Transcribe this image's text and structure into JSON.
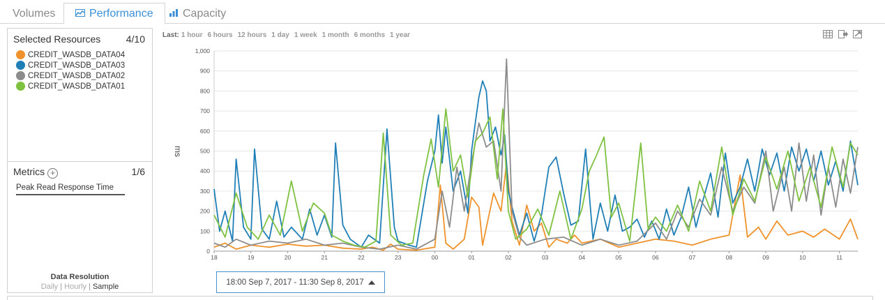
{
  "tabs": [
    {
      "label": "Volumes",
      "icon": "none"
    },
    {
      "label": "Performance",
      "icon": "line-chart-icon"
    },
    {
      "label": "Capacity",
      "icon": "bar-chart-icon"
    }
  ],
  "resources": {
    "title": "Selected Resources",
    "count": "4/10",
    "items": [
      {
        "name": "CREDIT_WASDB_DATA04",
        "color": "#f0922b"
      },
      {
        "name": "CREDIT_WASDB_DATA03",
        "color": "#1f7fb6"
      },
      {
        "name": "CREDIT_WASDB_DATA02",
        "color": "#8c8c8c"
      },
      {
        "name": "CREDIT_WASDB_DATA01",
        "color": "#7fc241"
      }
    ]
  },
  "metrics": {
    "title": "Metrics",
    "count": "1/6",
    "items": [
      "Peak Read Response Time"
    ]
  },
  "resolution": {
    "title": "Data Resolution",
    "options": [
      "Daily",
      "Hourly",
      "Sample"
    ],
    "selected": "Sample"
  },
  "timebar": {
    "label": "Last:",
    "options": [
      "1 hour",
      "6 hours",
      "12 hours",
      "1 day",
      "1 week",
      "1 month",
      "6 months",
      "1 year"
    ]
  },
  "tools": [
    "table-icon",
    "export-icon",
    "expand-icon"
  ],
  "range": {
    "label": "18:00 Sep 7, 2017 - 11:30 Sep 8, 2017"
  },
  "chart_data": {
    "type": "line",
    "ylabel": "ms",
    "xlabel": "",
    "ylim": [
      0,
      1000
    ],
    "yticks": [
      "0",
      "100",
      "200",
      "300",
      "400",
      "500",
      "600",
      "700",
      "800",
      "900",
      "1,000"
    ],
    "xticks": [
      "18",
      "19",
      "20",
      "21",
      "22",
      "23",
      "00",
      "01",
      "02",
      "03",
      "04",
      "05",
      "06",
      "07",
      "08",
      "09",
      "10",
      "11"
    ],
    "xrange": [
      0,
      17.5
    ],
    "grid": true,
    "series": [
      {
        "name": "CREDIT_WASDB_DATA04",
        "color": "#f0922b",
        "points": [
          [
            0,
            20
          ],
          [
            0.3,
            40
          ],
          [
            0.6,
            10
          ],
          [
            1,
            30
          ],
          [
            1.5,
            20
          ],
          [
            2,
            35
          ],
          [
            2.5,
            25
          ],
          [
            3,
            30
          ],
          [
            3.5,
            15
          ],
          [
            4,
            10
          ],
          [
            4.3,
            20
          ],
          [
            4.6,
            5
          ],
          [
            4.8,
            35
          ],
          [
            5,
            10
          ],
          [
            5.5,
            5
          ],
          [
            6,
            20
          ],
          [
            6.15,
            330
          ],
          [
            6.3,
            40
          ],
          [
            6.5,
            10
          ],
          [
            6.8,
            60
          ],
          [
            7,
            270
          ],
          [
            7.2,
            220
          ],
          [
            7.3,
            30
          ],
          [
            7.6,
            290
          ],
          [
            7.8,
            200
          ],
          [
            7.95,
            440
          ],
          [
            8.1,
            150
          ],
          [
            8.3,
            30
          ],
          [
            8.5,
            230
          ],
          [
            8.7,
            100
          ],
          [
            8.9,
            140
          ],
          [
            9.1,
            20
          ],
          [
            9.3,
            60
          ],
          [
            9.6,
            40
          ],
          [
            9.8,
            80
          ],
          [
            10,
            40
          ],
          [
            10.5,
            60
          ],
          [
            11,
            20
          ],
          [
            11.5,
            40
          ],
          [
            12,
            60
          ],
          [
            12.5,
            50
          ],
          [
            13,
            30
          ],
          [
            13.5,
            60
          ],
          [
            14,
            80
          ],
          [
            14.3,
            380
          ],
          [
            14.5,
            70
          ],
          [
            14.8,
            120
          ],
          [
            15,
            60
          ],
          [
            15.3,
            150
          ],
          [
            15.6,
            80
          ],
          [
            16,
            100
          ],
          [
            16.3,
            70
          ],
          [
            16.6,
            110
          ],
          [
            17,
            60
          ],
          [
            17.3,
            160
          ],
          [
            17.5,
            60
          ]
        ]
      },
      {
        "name": "CREDIT_WASDB_DATA03",
        "color": "#1f7fb6",
        "points": [
          [
            0,
            310
          ],
          [
            0.15,
            100
          ],
          [
            0.3,
            200
          ],
          [
            0.5,
            50
          ],
          [
            0.6,
            460
          ],
          [
            0.8,
            120
          ],
          [
            1,
            60
          ],
          [
            1.1,
            510
          ],
          [
            1.3,
            110
          ],
          [
            1.5,
            60
          ],
          [
            1.7,
            250
          ],
          [
            1.9,
            70
          ],
          [
            2.1,
            120
          ],
          [
            2.4,
            60
          ],
          [
            2.6,
            210
          ],
          [
            2.8,
            80
          ],
          [
            3,
            180
          ],
          [
            3.2,
            70
          ],
          [
            3.3,
            540
          ],
          [
            3.5,
            130
          ],
          [
            3.7,
            60
          ],
          [
            4,
            20
          ],
          [
            4.2,
            80
          ],
          [
            4.5,
            40
          ],
          [
            4.7,
            610
          ],
          [
            4.9,
            120
          ],
          [
            5,
            50
          ],
          [
            5.3,
            30
          ],
          [
            5.5,
            20
          ],
          [
            5.8,
            350
          ],
          [
            6,
            500
          ],
          [
            6.1,
            680
          ],
          [
            6.2,
            440
          ],
          [
            6.3,
            620
          ],
          [
            6.5,
            300
          ],
          [
            6.7,
            400
          ],
          [
            6.9,
            190
          ],
          [
            7,
            500
          ],
          [
            7.1,
            640
          ],
          [
            7.2,
            770
          ],
          [
            7.3,
            850
          ],
          [
            7.4,
            800
          ],
          [
            7.5,
            550
          ],
          [
            7.65,
            620
          ],
          [
            7.8,
            480
          ],
          [
            7.9,
            580
          ],
          [
            8,
            300
          ],
          [
            8.1,
            220
          ],
          [
            8.3,
            80
          ],
          [
            8.5,
            190
          ],
          [
            8.7,
            50
          ],
          [
            8.9,
            180
          ],
          [
            9.1,
            420
          ],
          [
            9.3,
            470
          ],
          [
            9.5,
            290
          ],
          [
            9.7,
            130
          ],
          [
            9.9,
            150
          ],
          [
            10.1,
            510
          ],
          [
            10.3,
            60
          ],
          [
            10.5,
            240
          ],
          [
            10.7,
            100
          ],
          [
            10.9,
            280
          ],
          [
            11.1,
            100
          ],
          [
            11.3,
            120
          ],
          [
            11.5,
            160
          ],
          [
            11.7,
            70
          ],
          [
            11.9,
            150
          ],
          [
            12.1,
            60
          ],
          [
            12.3,
            210
          ],
          [
            12.5,
            80
          ],
          [
            12.7,
            170
          ],
          [
            12.9,
            320
          ],
          [
            13.1,
            120
          ],
          [
            13.3,
            260
          ],
          [
            13.5,
            390
          ],
          [
            13.7,
            170
          ],
          [
            13.9,
            490
          ],
          [
            14.1,
            240
          ],
          [
            14.3,
            320
          ],
          [
            14.5,
            460
          ],
          [
            14.7,
            300
          ],
          [
            14.9,
            510
          ],
          [
            15.1,
            380
          ],
          [
            15.3,
            490
          ],
          [
            15.5,
            300
          ],
          [
            15.7,
            520
          ],
          [
            15.9,
            400
          ],
          [
            16.1,
            510
          ],
          [
            16.3,
            350
          ],
          [
            16.5,
            500
          ],
          [
            16.7,
            330
          ],
          [
            16.9,
            450
          ],
          [
            17.1,
            300
          ],
          [
            17.3,
            550
          ],
          [
            17.5,
            330
          ]
        ]
      },
      {
        "name": "CREDIT_WASDB_DATA02",
        "color": "#8c8c8c",
        "points": [
          [
            0,
            40
          ],
          [
            0.3,
            20
          ],
          [
            0.6,
            60
          ],
          [
            1,
            30
          ],
          [
            1.5,
            50
          ],
          [
            2,
            40
          ],
          [
            2.5,
            60
          ],
          [
            3,
            30
          ],
          [
            3.5,
            40
          ],
          [
            4,
            20
          ],
          [
            4.5,
            10
          ],
          [
            5,
            30
          ],
          [
            5.5,
            10
          ],
          [
            6,
            60
          ],
          [
            6.2,
            300
          ],
          [
            6.4,
            120
          ],
          [
            6.6,
            420
          ],
          [
            6.8,
            200
          ],
          [
            7,
            440
          ],
          [
            7.2,
            640
          ],
          [
            7.4,
            520
          ],
          [
            7.6,
            550
          ],
          [
            7.8,
            300
          ],
          [
            7.95,
            960
          ],
          [
            8.1,
            200
          ],
          [
            8.3,
            70
          ],
          [
            8.5,
            30
          ],
          [
            9,
            60
          ],
          [
            9.5,
            70
          ],
          [
            10,
            30
          ],
          [
            10.5,
            60
          ],
          [
            11,
            30
          ],
          [
            11.5,
            50
          ],
          [
            12,
            140
          ],
          [
            12.3,
            60
          ],
          [
            12.6,
            200
          ],
          [
            12.9,
            120
          ],
          [
            13.2,
            260
          ],
          [
            13.5,
            180
          ],
          [
            13.8,
            420
          ],
          [
            14.1,
            200
          ],
          [
            14.4,
            320
          ],
          [
            14.7,
            240
          ],
          [
            15,
            500
          ],
          [
            15.2,
            200
          ],
          [
            15.5,
            420
          ],
          [
            15.7,
            200
          ],
          [
            15.9,
            540
          ],
          [
            16.1,
            250
          ],
          [
            16.3,
            480
          ],
          [
            16.5,
            180
          ],
          [
            16.7,
            420
          ],
          [
            16.9,
            220
          ],
          [
            17.1,
            460
          ],
          [
            17.3,
            290
          ],
          [
            17.5,
            520
          ]
        ]
      },
      {
        "name": "CREDIT_WASDB_DATA01",
        "color": "#7fc241",
        "points": [
          [
            0,
            180
          ],
          [
            0.3,
            70
          ],
          [
            0.6,
            290
          ],
          [
            0.9,
            120
          ],
          [
            1.2,
            60
          ],
          [
            1.5,
            180
          ],
          [
            1.8,
            80
          ],
          [
            2.1,
            350
          ],
          [
            2.4,
            100
          ],
          [
            2.7,
            240
          ],
          [
            3,
            190
          ],
          [
            3.2,
            80
          ],
          [
            3.5,
            50
          ],
          [
            3.8,
            30
          ],
          [
            4.1,
            20
          ],
          [
            4.4,
            50
          ],
          [
            4.6,
            590
          ],
          [
            4.8,
            80
          ],
          [
            5.1,
            30
          ],
          [
            5.4,
            40
          ],
          [
            5.7,
            380
          ],
          [
            5.9,
            560
          ],
          [
            6.1,
            320
          ],
          [
            6.3,
            710
          ],
          [
            6.5,
            400
          ],
          [
            6.7,
            480
          ],
          [
            6.9,
            270
          ],
          [
            7.1,
            550
          ],
          [
            7.3,
            590
          ],
          [
            7.5,
            670
          ],
          [
            7.7,
            360
          ],
          [
            7.85,
            710
          ],
          [
            8,
            200
          ],
          [
            8.2,
            60
          ],
          [
            8.5,
            110
          ],
          [
            8.8,
            210
          ],
          [
            9.1,
            80
          ],
          [
            9.4,
            300
          ],
          [
            9.7,
            60
          ],
          [
            10,
            210
          ],
          [
            10.2,
            400
          ],
          [
            10.4,
            480
          ],
          [
            10.6,
            570
          ],
          [
            10.8,
            170
          ],
          [
            11,
            240
          ],
          [
            11.3,
            50
          ],
          [
            11.6,
            540
          ],
          [
            11.8,
            110
          ],
          [
            12,
            170
          ],
          [
            12.3,
            100
          ],
          [
            12.6,
            230
          ],
          [
            12.9,
            100
          ],
          [
            13.2,
            350
          ],
          [
            13.5,
            200
          ],
          [
            13.8,
            520
          ],
          [
            14.1,
            180
          ],
          [
            14.4,
            360
          ],
          [
            14.7,
            250
          ],
          [
            15,
            470
          ],
          [
            15.3,
            310
          ],
          [
            15.6,
            500
          ],
          [
            15.9,
            250
          ],
          [
            16.2,
            420
          ],
          [
            16.5,
            220
          ],
          [
            16.8,
            520
          ],
          [
            17.1,
            320
          ],
          [
            17.3,
            540
          ],
          [
            17.5,
            480
          ]
        ]
      }
    ]
  }
}
